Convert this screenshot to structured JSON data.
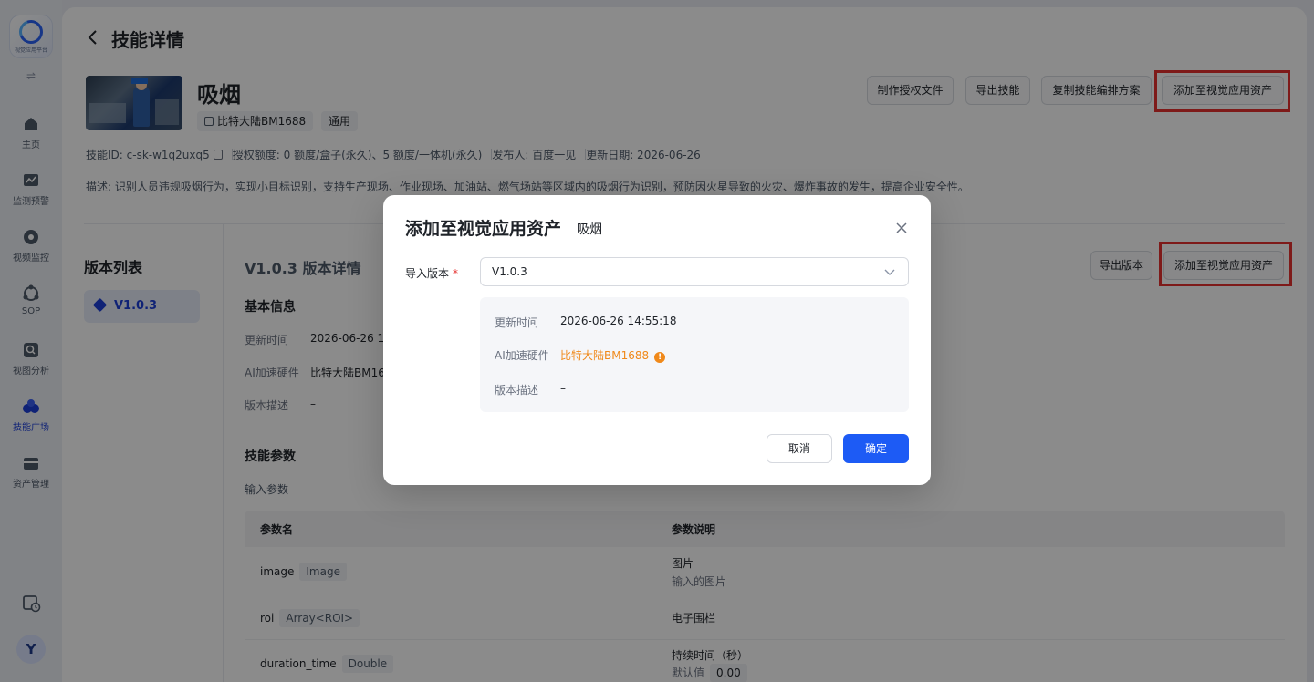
{
  "app": {
    "logo_text": "视觉应用平台",
    "user_initial": "Y"
  },
  "sidebar": {
    "items": [
      {
        "label": "主页",
        "icon": "home-icon"
      },
      {
        "label": "监测预警",
        "icon": "monitor-chart-icon"
      },
      {
        "label": "视频监控",
        "icon": "camera-icon"
      },
      {
        "label": "SOP",
        "icon": "sop-icon"
      },
      {
        "label": "视图分析",
        "icon": "view-analysis-icon"
      },
      {
        "label": "技能广场",
        "icon": "skill-plaza-icon"
      },
      {
        "label": "资产管理",
        "icon": "asset-icon"
      }
    ]
  },
  "page": {
    "title": "技能详情",
    "skill_name": "吸烟",
    "hardware_chip": "比特大陆BM1688",
    "general_chip": "通用",
    "meta": {
      "skill_id": "技能ID:  c-sk-w1q2uxq5",
      "quota": "授权额度:  0 额度/盒子(永久)、5 额度/一体机(永久)",
      "publisher": "发布人:  百度一见",
      "update_date": "更新日期:  2026-06-26"
    },
    "description": "描述:  识别人员违规吸烟行为，实现小目标识别，支持生产现场、作业现场、加油站、燃气场站等区域内的吸烟行为识别，预防因火星导致的火灾、爆炸事故的发生，提高企业安全性。",
    "buttons": {
      "make_auth": "制作授权文件",
      "export_skill": "导出技能",
      "copy_plan": "复制技能编排方案",
      "add_to_assets": "添加至视觉应用资产"
    }
  },
  "versions": {
    "list_title": "版本列表",
    "items": [
      "V1.0.3"
    ],
    "detail_title": "V1.0.3 版本详情",
    "export_version": "导出版本",
    "add_to_assets": "添加至视觉应用资产",
    "basic_info_title": "基本信息",
    "basic_info": [
      {
        "label": "更新时间",
        "value": "2026-06-26 1"
      },
      {
        "label": "AI加速硬件",
        "value": "比特大陆BM16"
      },
      {
        "label": "版本描述",
        "value": "–"
      }
    ],
    "params_title": "技能参数",
    "input_params_label": "输入参数",
    "table": {
      "headers": [
        "参数名",
        "参数说明"
      ],
      "rows": [
        {
          "name": "image",
          "type": "Image",
          "desc": "图片",
          "desc2": "输入的图片"
        },
        {
          "name": "roi",
          "type": "Array<ROI>",
          "desc": "电子围栏",
          "desc2": ""
        },
        {
          "name": "duration_time",
          "type": "Double",
          "desc": "持续时间（秒）",
          "desc2_label": "默认值",
          "desc2_value": "0.00"
        }
      ]
    }
  },
  "modal": {
    "title": "添加至视觉应用资产",
    "subtitle": "吸烟",
    "import_version_label": "导入版本",
    "required_mark": "*",
    "selected_version": "V1.0.3",
    "info": [
      {
        "label": "更新时间",
        "value": "2026-06-26 14:55:18"
      },
      {
        "label": "AI加速硬件",
        "value": "比特大陆BM1688"
      },
      {
        "label": "版本描述",
        "value": "–"
      }
    ],
    "warning_mark": "!",
    "cancel": "取消",
    "confirm": "确定"
  },
  "colors": {
    "primary": "#1d5bf5",
    "warning": "#f0891a",
    "highlight_box": "#e5312f"
  }
}
